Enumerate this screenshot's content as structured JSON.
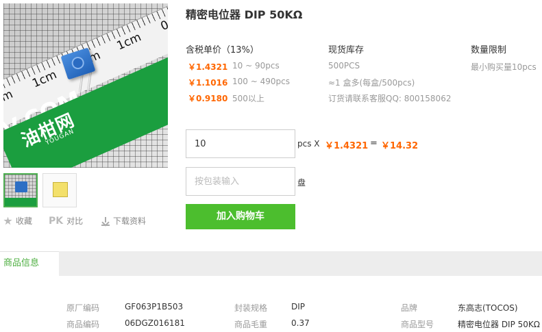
{
  "product": {
    "title": "精密电位器 DIP 50KΩ",
    "image": {
      "ruler_labels": [
        "0cm",
        "1cm",
        "0cm",
        "1cm",
        "0cm"
      ],
      "brand_text": "油柑网",
      "brand_small": "YOUGAN",
      "domain_text": "V.COM"
    }
  },
  "actions": {
    "favorite": "收藏",
    "pk_mark": "PK",
    "compare": "对比",
    "download": "下载资料"
  },
  "pricing": {
    "header": "含税单价（13%）",
    "tiers": [
      {
        "price": "￥1.4321",
        "range": "10 ~ 90pcs"
      },
      {
        "price": "￥1.1016",
        "range": "100 ~ 490pcs"
      },
      {
        "price": "￥0.9180",
        "range": "500以上"
      }
    ]
  },
  "stock": {
    "header": "现货库存",
    "lines": [
      "500PCS",
      "≈1 盒多(每盒/500pcs)",
      "订货请联系客服QQ: 800158062"
    ]
  },
  "limit": {
    "header": "数量限制",
    "text": "最小购买量10pcs"
  },
  "order": {
    "quantity_value": "10",
    "unit_label": "pcs X",
    "unit_price": "￥1.4321",
    "equals": "=",
    "total": "￥14.32",
    "pack_placeholder": "按包装输入",
    "pack_unit": "盘",
    "add_to_cart": "加入购物车"
  },
  "tabs": {
    "active": "商品信息"
  },
  "info": {
    "rows": [
      [
        {
          "label": "原厂编码",
          "value": "GF063P1B503"
        },
        {
          "label": "封装规格",
          "value": "DIP"
        },
        {
          "label": "品牌",
          "value": "东高志(TOCOS)"
        }
      ],
      [
        {
          "label": "商品编码",
          "value": "06DGZ016181"
        },
        {
          "label": "商品毛重",
          "value": "0.37"
        },
        {
          "label": "商品型号",
          "value": "精密电位器 DIP 50KΩ"
        }
      ]
    ]
  },
  "colors": {
    "accent_green": "#4cbe2e",
    "price_orange": "#ff6600",
    "tab_green": "#4cae3f"
  }
}
